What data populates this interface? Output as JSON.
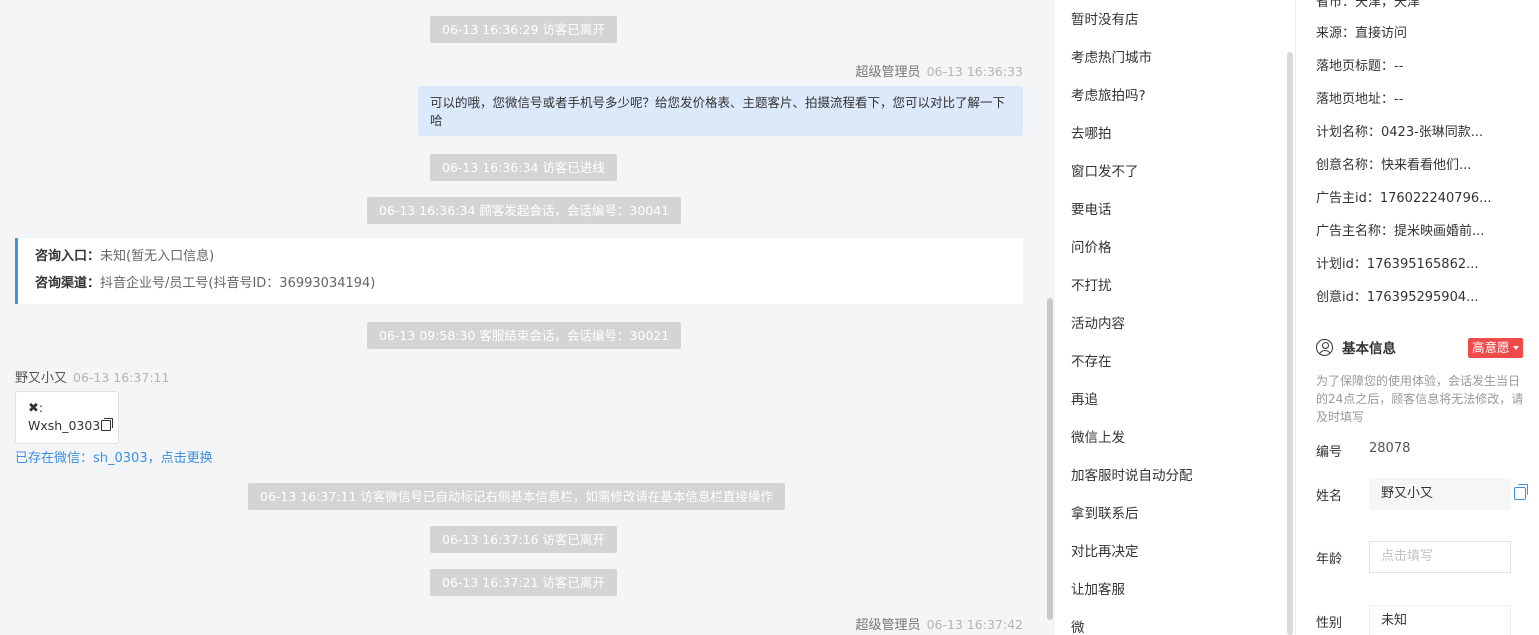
{
  "chat": {
    "messages": [
      {
        "type": "system",
        "text": "06-13 16:36:29 访客已离开"
      },
      {
        "type": "agent_meta",
        "name": "超级管理员",
        "time": "06-13 16:36:33"
      },
      {
        "type": "agent_message",
        "text": "可以的哦，您微信号或者手机号多少呢？给您发价格表、主题客片、拍摄流程看下，您可以对比了解一下哈"
      },
      {
        "type": "system",
        "text": "06-13 16:36:34 访客已进线"
      },
      {
        "type": "system",
        "text": "06-13 16:36:34 顾客发起会话，会话编号：30041"
      },
      {
        "type": "entry_info",
        "entry_label": "咨询入口：",
        "entry_value": "未知(暂无入口信息)",
        "channel_label": "咨询渠道：",
        "channel_value": "抖音企业号/员工号(抖音号ID：36993034194)"
      },
      {
        "type": "system",
        "text": "06-13 09:58:30 客服结束会话，会话编号：30021"
      },
      {
        "type": "visitor_meta",
        "name": "野又小又",
        "time": "06-13 16:37:11"
      },
      {
        "type": "visitor_wechat",
        "line1": ":",
        "line2": "Wxsh_0303"
      },
      {
        "type": "link",
        "text": "已存在微信：sh_0303，点击更换"
      },
      {
        "type": "system",
        "text": "06-13 16:37:11 访客微信号已自动标记右侧基本信息栏，如需修改请在基本信息栏直接操作"
      },
      {
        "type": "system",
        "text": "06-13 16:37:16 访客已离开"
      },
      {
        "type": "system",
        "text": "06-13 16:37:21 访客已离开"
      },
      {
        "type": "agent_meta",
        "name": "超级管理员",
        "time": "06-13 16:37:42"
      }
    ]
  },
  "quick_replies": [
    "暂时没有店",
    "考虑热门城市",
    "考虑旅拍吗?",
    "去哪拍",
    "窗口发不了",
    "要电话",
    "问价格",
    "不打扰",
    "活动内容",
    "不存在",
    "再追",
    "微信上发",
    "加客服时说自动分配",
    "拿到联系后",
    "对比再决定",
    "让加客服",
    "微"
  ],
  "info": {
    "top_cut": "省市：天津，天津",
    "details": [
      "来源：直接访问",
      "落地页标题：--",
      "落地页地址：--",
      "计划名称：0423-张琳同款...",
      "创意名称：快来看看他们...",
      "广告主id：176022240796...",
      "广告主名称：提米映画婚前...",
      "计划id：176395165862...",
      "创意id：176395295904..."
    ],
    "basic_title": "基本信息",
    "intent_badge": "高意愿",
    "note": "为了保障您的使用体验，会话发生当日的24点之后，顾客信息将无法修改，请及时填写",
    "id_label": "编号",
    "id_value": "28078",
    "name_label": "姓名",
    "name_value": "野又小又",
    "age_label": "年龄",
    "age_placeholder": "点击填写",
    "gender_label": "性别",
    "gender_value": "未知"
  }
}
